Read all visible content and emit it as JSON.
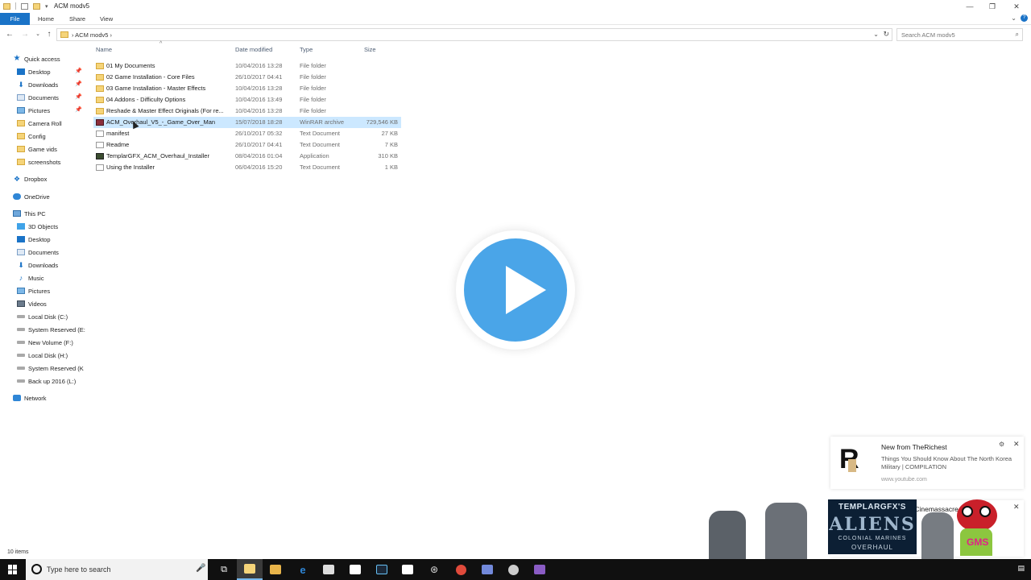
{
  "window": {
    "title": "ACM modv5",
    "minimize_glyph": "—",
    "restore_glyph": "❐",
    "close_glyph": "✕"
  },
  "ribbon": {
    "tabs": [
      "File",
      "Home",
      "Share",
      "View"
    ],
    "expand_glyph": "⌄",
    "help_glyph": "?"
  },
  "address": {
    "path": "ACM modv5",
    "crumb_prefix": "›",
    "crumb_suffix": "›",
    "search_placeholder": "Search ACM modv5"
  },
  "nav": {
    "quick_access": {
      "label": "Quick access",
      "items": [
        {
          "label": "Desktop",
          "icon": "desktop-icon",
          "pinned": true
        },
        {
          "label": "Downloads",
          "icon": "download-icon",
          "pinned": true
        },
        {
          "label": "Documents",
          "icon": "documents-icon",
          "pinned": true
        },
        {
          "label": "Pictures",
          "icon": "pictures-icon",
          "pinned": true
        },
        {
          "label": "Camera Roll",
          "icon": "folder-icon",
          "pinned": false
        },
        {
          "label": "Config",
          "icon": "folder-icon",
          "pinned": false
        },
        {
          "label": "Game vids",
          "icon": "folder-icon",
          "pinned": false
        },
        {
          "label": "screenshots",
          "icon": "folder-icon",
          "pinned": false
        }
      ]
    },
    "dropbox": "Dropbox",
    "onedrive": "OneDrive",
    "this_pc": {
      "label": "This PC",
      "items": [
        {
          "label": "3D Objects",
          "icon": "3d-objects-icon"
        },
        {
          "label": "Desktop",
          "icon": "desktop-icon"
        },
        {
          "label": "Documents",
          "icon": "documents-icon"
        },
        {
          "label": "Downloads",
          "icon": "download-icon"
        },
        {
          "label": "Music",
          "icon": "music-icon"
        },
        {
          "label": "Pictures",
          "icon": "pictures-icon"
        },
        {
          "label": "Videos",
          "icon": "videos-icon"
        },
        {
          "label": "Local Disk (C:)",
          "icon": "drive-icon"
        },
        {
          "label": "System Reserved (E:",
          "icon": "drive-icon"
        },
        {
          "label": "New Volume (F:)",
          "icon": "drive-icon"
        },
        {
          "label": "Local Disk (H:)",
          "icon": "drive-icon"
        },
        {
          "label": "System Reserved (K",
          "icon": "drive-icon"
        },
        {
          "label": "Back up 2016 (L:)",
          "icon": "drive-icon"
        }
      ]
    },
    "network": "Network"
  },
  "columns": {
    "name": "Name",
    "date": "Date modified",
    "type": "Type",
    "size": "Size"
  },
  "files": [
    {
      "name": "01 My Documents",
      "date": "10/04/2016 13:28",
      "type": "File folder",
      "size": "",
      "icon": "folder"
    },
    {
      "name": "02 Game Installation - Core Files",
      "date": "26/10/2017 04:41",
      "type": "File folder",
      "size": "",
      "icon": "folder"
    },
    {
      "name": "03 Game Installation - Master Effects",
      "date": "10/04/2016 13:28",
      "type": "File folder",
      "size": "",
      "icon": "folder"
    },
    {
      "name": "04 Addons - Difficulty Options",
      "date": "10/04/2016 13:49",
      "type": "File folder",
      "size": "",
      "icon": "folder"
    },
    {
      "name": "Reshade & Master Effect Originals (For re...",
      "date": "10/04/2016 13:28",
      "type": "File folder",
      "size": "",
      "icon": "folder"
    },
    {
      "name": "ACM_Overhaul_V5_-_Game_Over_Man",
      "date": "15/07/2018 18:28",
      "type": "WinRAR archive",
      "size": "729,546 KB",
      "icon": "rar",
      "selected": true
    },
    {
      "name": "manifest",
      "date": "26/10/2017 05:32",
      "type": "Text Document",
      "size": "27 KB",
      "icon": "txt"
    },
    {
      "name": "Readme",
      "date": "26/10/2017 04:41",
      "type": "Text Document",
      "size": "7 KB",
      "icon": "txt"
    },
    {
      "name": "TemplarGFX_ACM_Overhaul_Installer",
      "date": "08/04/2016 01:04",
      "type": "Application",
      "size": "310 KB",
      "icon": "app"
    },
    {
      "name": "Using the Installer",
      "date": "06/04/2016 15:20",
      "type": "Text Document",
      "size": "1 KB",
      "icon": "txt"
    }
  ],
  "status": {
    "item_count": "10 items"
  },
  "notification": {
    "title": "New from TheRichest",
    "body": "Things You Should Know About The North Korea Military | COMPILATION",
    "url": "www.youtube.com",
    "logo_letter": "R",
    "gear_glyph": "⚙",
    "close_glyph": "✕"
  },
  "notification2": {
    "title": "from Cinemassacre",
    "close_glyph": "✕"
  },
  "overlay": {
    "line1": "TEMPLARGFX'S",
    "line2": "ALIENS",
    "line3": "COLONIAL MARINES",
    "line4": "OVERHAUL",
    "mascot_text": "GMS"
  },
  "taskbar": {
    "search_placeholder": "Type here to search"
  },
  "play_overlay": {
    "accent": "#4aa5e8"
  }
}
